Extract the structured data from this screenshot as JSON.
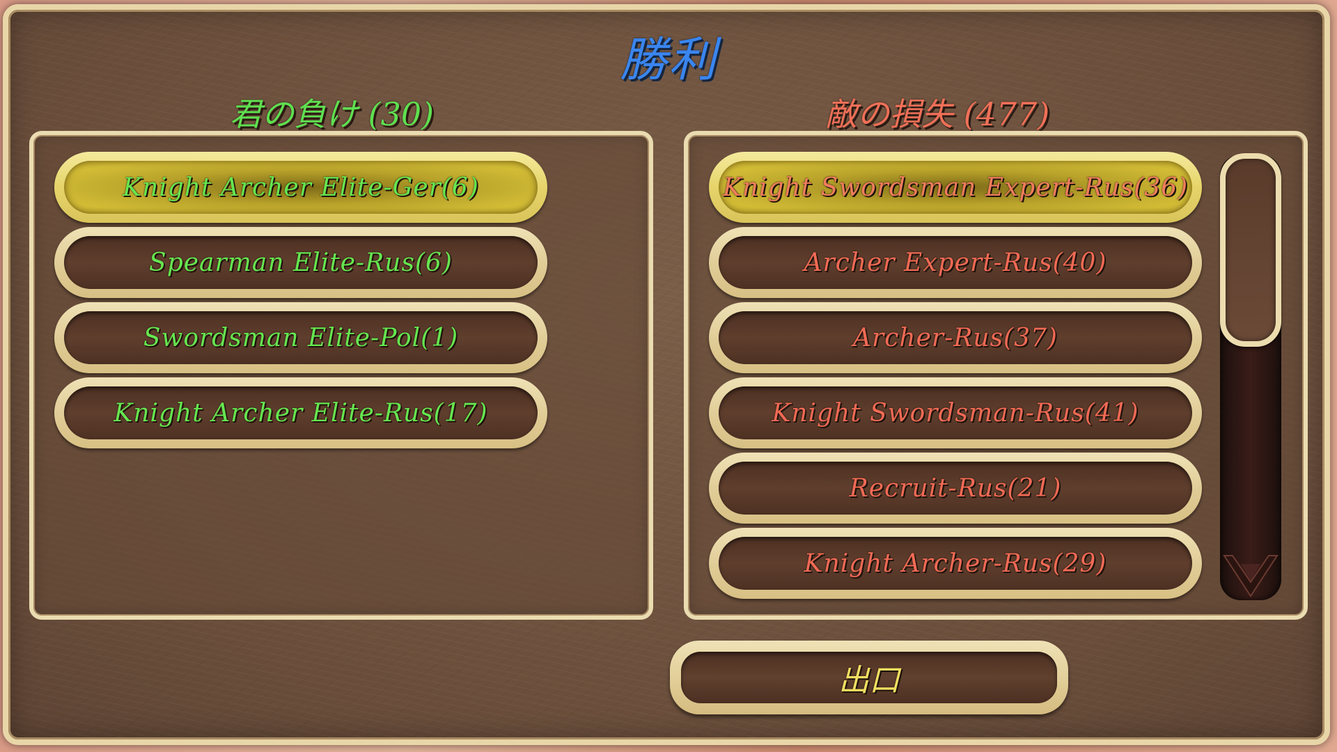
{
  "screen": {
    "title": "勝利",
    "title_color": "#3a86f0"
  },
  "ally": {
    "header": "君の負け (30)",
    "header_color": "#5fe050",
    "units": [
      {
        "label": "Knight Archer Elite-Ger(6)",
        "selected": true
      },
      {
        "label": "Spearman Elite-Rus(6)",
        "selected": false
      },
      {
        "label": "Swordsman Elite-Pol(1)",
        "selected": false
      },
      {
        "label": "Knight Archer Elite-Rus(17)",
        "selected": false
      }
    ]
  },
  "enemy": {
    "header": "敵の損失 (477)",
    "header_color": "#f07058",
    "units": [
      {
        "label": "Knight Swordsman Expert-Rus(36)",
        "selected": true
      },
      {
        "label": "Archer Expert-Rus(40)",
        "selected": false
      },
      {
        "label": "Archer-Rus(37)",
        "selected": false
      },
      {
        "label": "Knight Swordsman-Rus(41)",
        "selected": false
      },
      {
        "label": "Recruit-Rus(21)",
        "selected": false
      },
      {
        "label": "Knight Archer-Rus(29)",
        "selected": false
      }
    ]
  },
  "exit_button": {
    "label": "出口",
    "color": "#f2df62"
  },
  "scrollbar": {
    "icons": {
      "down": "chevron-down-icon"
    }
  }
}
